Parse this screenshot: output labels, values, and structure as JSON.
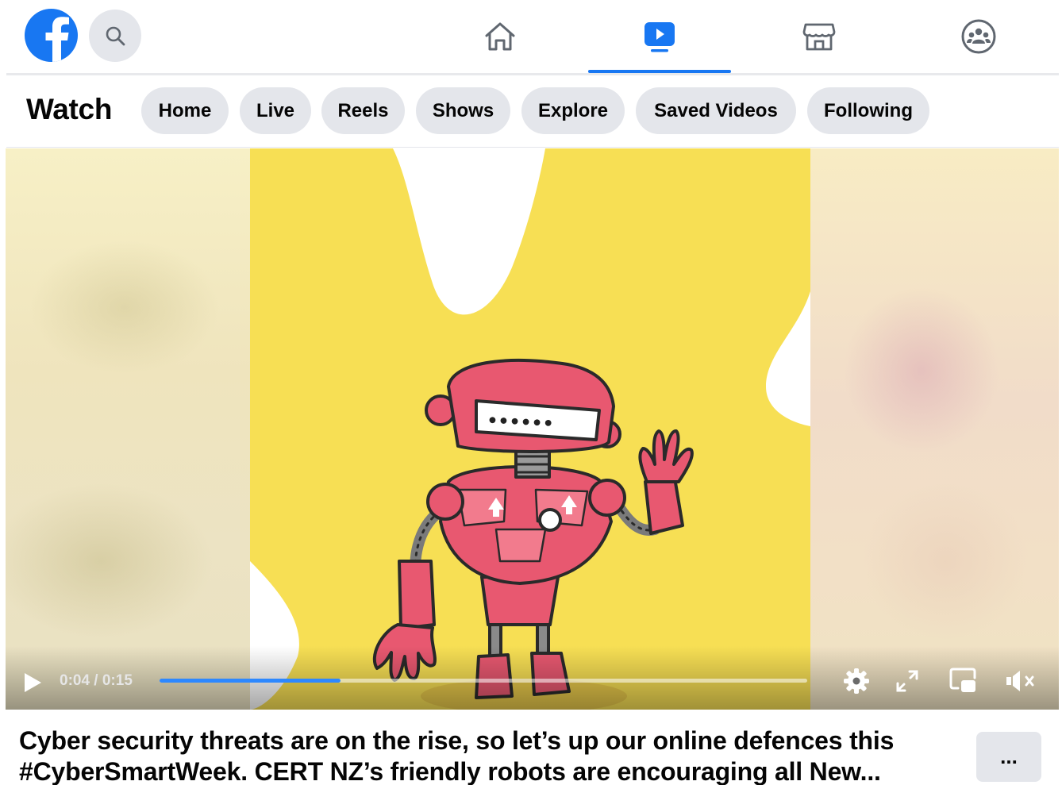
{
  "nav": {
    "tabs": [
      {
        "name": "Home",
        "icon": "home-icon"
      },
      {
        "name": "Watch",
        "icon": "watch-icon",
        "active": true
      },
      {
        "name": "Marketplace",
        "icon": "marketplace-icon"
      },
      {
        "name": "Groups",
        "icon": "groups-icon"
      }
    ],
    "accent_color": "#1877f2"
  },
  "watch": {
    "title": "Watch",
    "pills": [
      "Home",
      "Live",
      "Reels",
      "Shows",
      "Explore",
      "Saved Videos",
      "Following"
    ]
  },
  "video": {
    "time": "0:04 / 0:15",
    "progress_fraction": 0.28,
    "password_display": "••••••",
    "controls": [
      "play-icon",
      "settings-icon",
      "fullscreen-icon",
      "mini-player-icon",
      "muted-volume-icon"
    ]
  },
  "post": {
    "caption": "Cyber security threats are on the rise, so let’s up our online defences this #CyberSmartWeek. CERT NZ’s friendly robots are encouraging all New...",
    "more_label": "..."
  }
}
